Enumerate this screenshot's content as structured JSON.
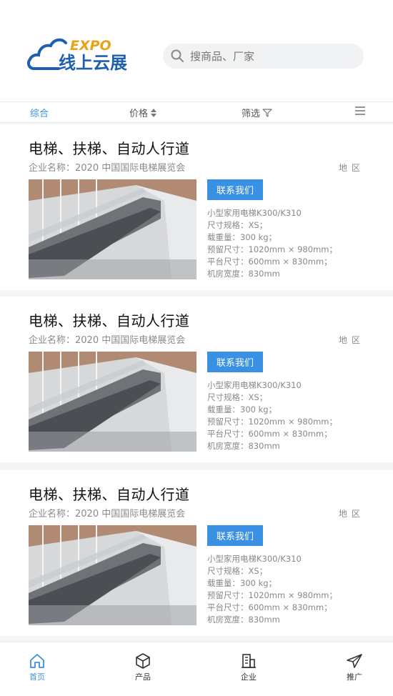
{
  "header": {
    "logo_expo": "EXPO",
    "logo_text": "线上云展",
    "search_placeholder": "搜商品、厂家"
  },
  "filters": [
    {
      "label": "综合"
    },
    {
      "label": "价格"
    },
    {
      "label": "筛选"
    }
  ],
  "products": [
    {
      "title": "电梯、扶梯、自动人行道",
      "company": "企业名称：2020 中国国际电梯展览会",
      "region": "地区",
      "contact_label": "联系我们",
      "specs": [
        "小型家用电梯K300/K310",
        "尺寸规格：XS；",
        "载重量：300 kg；",
        "预留尺寸：1020mm × 980mm；",
        "平台尺寸：600mm × 830mm；",
        "机房宽度：830mm"
      ]
    },
    {
      "title": "电梯、扶梯、自动人行道",
      "company": "企业名称：2020 中国国际电梯展览会",
      "region": "地区",
      "contact_label": "联系我们",
      "specs": [
        "小型家用电梯K300/K310",
        "尺寸规格：XS；",
        "载重量：300 kg；",
        "预留尺寸：1020mm × 980mm；",
        "平台尺寸：600mm × 830mm；",
        "机房宽度：830mm"
      ]
    },
    {
      "title": "电梯、扶梯、自动人行道",
      "company": "企业名称：2020 中国国际电梯展览会",
      "region": "地区",
      "contact_label": "联系我们",
      "specs": [
        "小型家用电梯K300/K310",
        "尺寸规格：XS；",
        "载重量：300 kg；",
        "预留尺寸：1020mm × 980mm；",
        "平台尺寸：600mm × 830mm；",
        "机房宽度：830mm"
      ]
    }
  ],
  "tabbar": [
    {
      "label": "首页",
      "icon": "home-icon"
    },
    {
      "label": "产品",
      "icon": "box-icon"
    },
    {
      "label": "企业",
      "icon": "building-icon"
    },
    {
      "label": "推广",
      "icon": "send-icon"
    }
  ],
  "colors": {
    "accent": "#3a91e3",
    "logo_blue": "#1f5fb0",
    "logo_orange": "#e8a21a"
  }
}
